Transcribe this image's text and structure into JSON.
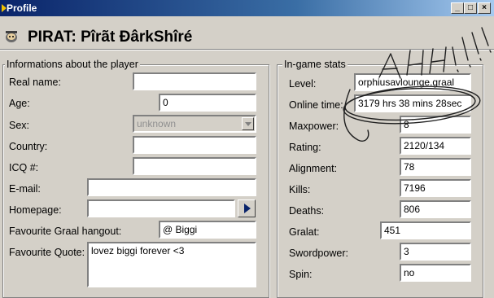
{
  "window": {
    "title": "Profile",
    "min_label": "_",
    "max_label": "□",
    "close_label": "×"
  },
  "header": {
    "title": "PIRAT: Pîrãt ÐârkShîré"
  },
  "player": {
    "legend": "Informations about the player",
    "real_name": {
      "label": "Real name:",
      "value": ""
    },
    "age": {
      "label": "Age:",
      "value": "0"
    },
    "sex": {
      "label": "Sex:",
      "value": "unknown"
    },
    "country": {
      "label": "Country:",
      "value": ""
    },
    "icq": {
      "label": "ICQ #:",
      "value": ""
    },
    "email": {
      "label": "E-mail:",
      "value": ""
    },
    "homepage": {
      "label": "Homepage:",
      "value": ""
    },
    "hangout": {
      "label": "Favourite Graal hangout:",
      "value": "@ Biggi"
    },
    "quote": {
      "label": "Favourite Quote:",
      "value": "lovez biggi forever <3"
    }
  },
  "stats": {
    "legend": "In-game stats",
    "level": {
      "label": "Level:",
      "value": "orphiusavlounge.graal"
    },
    "online_time": {
      "label": "Online time:",
      "value": "3179 hrs 38 mins 28sec"
    },
    "maxpower": {
      "label": "Maxpower:",
      "value": "8"
    },
    "rating": {
      "label": "Rating:",
      "value": "2120/134"
    },
    "alignment": {
      "label": "Alignment:",
      "value": "78"
    },
    "kills": {
      "label": "Kills:",
      "value": "7196"
    },
    "deaths": {
      "label": "Deaths:",
      "value": "806"
    },
    "gralat": {
      "label": "Gralat:",
      "value": "451"
    },
    "swordpower": {
      "label": "Swordpower:",
      "value": "3"
    },
    "spin": {
      "label": "Spin:",
      "value": "no"
    }
  },
  "annotation": {
    "text": "AHH!!!"
  }
}
